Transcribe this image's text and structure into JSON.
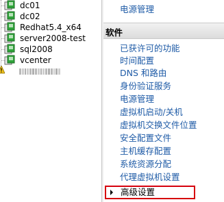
{
  "tree": {
    "items": [
      {
        "label": "dc01"
      },
      {
        "label": "dc02"
      },
      {
        "label": "Redhat5.4_x64"
      },
      {
        "label": "server2008-test"
      },
      {
        "label": "sql2008"
      },
      {
        "label": "vcenter"
      }
    ],
    "blurred_item": {
      "label_redacted": true
    }
  },
  "panel": {
    "top_link": "电源管理",
    "section_title": "软件",
    "links": [
      "已获许可的功能",
      "时间配置",
      "DNS 和路由",
      "身份验证服务",
      "电源管理",
      "虚拟机启动/关机",
      "虚拟机交换文件位置",
      "安全配置文件",
      "主机缓存配置",
      "系统资源分配",
      "代理虚拟机设置"
    ],
    "advanced_label": "高级设置"
  },
  "colors": {
    "link": "#1d5aa6",
    "highlight_border": "#d6000c",
    "vm_icon_green": "#2fa43a"
  }
}
